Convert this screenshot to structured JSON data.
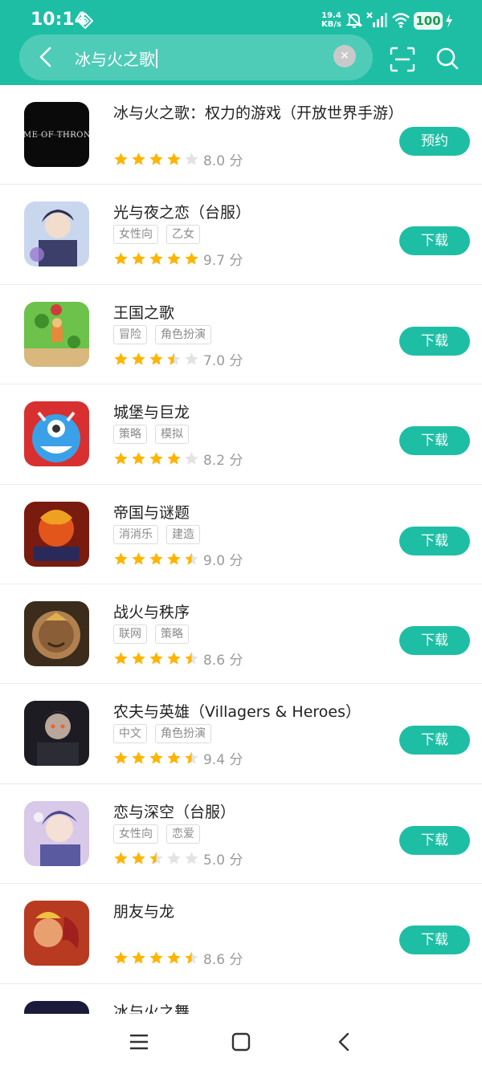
{
  "status_bar": {
    "time": "10:14",
    "net_speed_value": "19.4",
    "net_speed_unit": "KB/s",
    "battery": "100"
  },
  "search": {
    "query": "冰与火之歌"
  },
  "colors": {
    "accent": "#1ebea5",
    "star": "#ffb400",
    "star_empty": "#e3e3e3"
  },
  "apps": [
    {
      "name": "冰与火之歌：权力的游戏（开放世界手游）",
      "tags": [],
      "stars": 4,
      "score": "8.0 分",
      "button": "预约"
    },
    {
      "name": "光与夜之恋（台服）",
      "tags": [
        "女性向",
        "乙女"
      ],
      "stars": 5,
      "score": "9.7 分",
      "button": "下载"
    },
    {
      "name": "王国之歌",
      "tags": [
        "冒险",
        "角色扮演"
      ],
      "stars": 3.5,
      "score": "7.0 分",
      "button": "下载"
    },
    {
      "name": "城堡与巨龙",
      "tags": [
        "策略",
        "模拟"
      ],
      "stars": 4,
      "score": "8.2 分",
      "button": "下载"
    },
    {
      "name": "帝国与谜题",
      "tags": [
        "消消乐",
        "建造"
      ],
      "stars": 4.5,
      "score": "9.0 分",
      "button": "下载"
    },
    {
      "name": "战火与秩序",
      "tags": [
        "联网",
        "策略"
      ],
      "stars": 4.5,
      "score": "8.6 分",
      "button": "下载"
    },
    {
      "name": "农夫与英雄（Villagers & Heroes）",
      "tags": [
        "中文",
        "角色扮演"
      ],
      "stars": 4.5,
      "score": "9.4 分",
      "button": "下载"
    },
    {
      "name": "恋与深空（台服）",
      "tags": [
        "女性向",
        "恋爱"
      ],
      "stars": 2.5,
      "score": "5.0 分",
      "button": "下载"
    },
    {
      "name": "朋友与龙",
      "tags": [],
      "stars": 4.5,
      "score": "8.6 分",
      "button": "下载"
    },
    {
      "name": "冰与火之舞",
      "tags": [],
      "stars": 0,
      "score": "",
      "button": ""
    }
  ],
  "nav": {
    "icons": [
      "menu-icon",
      "home-square-icon",
      "back-chevron-icon"
    ]
  }
}
